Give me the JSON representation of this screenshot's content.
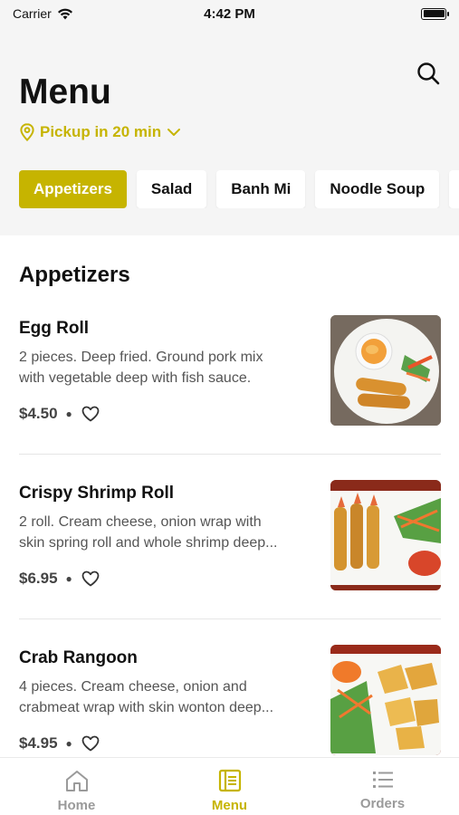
{
  "status_bar": {
    "carrier": "Carrier",
    "time": "4:42 PM"
  },
  "header": {
    "title": "Menu",
    "pickup_label": "Pickup in 20 min"
  },
  "categories": [
    {
      "label": "Appetizers",
      "active": true
    },
    {
      "label": "Salad",
      "active": false
    },
    {
      "label": "Banh Mi",
      "active": false
    },
    {
      "label": "Noodle Soup",
      "active": false
    }
  ],
  "section": {
    "title": "Appetizers"
  },
  "menu_items": [
    {
      "name": "Egg Roll",
      "desc_line1": "2 pieces. Deep fried. Ground pork mix",
      "desc_line2": "with vegetable deep with fish sauce.",
      "price": "$4.50"
    },
    {
      "name": "Crispy Shrimp Roll",
      "desc_line1": "2 roll. Cream cheese, onion wrap with",
      "desc_line2": "skin spring roll and whole shrimp deep...",
      "price": "$6.95"
    },
    {
      "name": "Crab Rangoon",
      "desc_line1": "4 pieces. Cream cheese, onion and",
      "desc_line2": "crabmeat wrap with skin wonton deep...",
      "price": "$4.95"
    }
  ],
  "tab_bar": {
    "home": "Home",
    "menu": "Menu",
    "orders": "Orders"
  },
  "colors": {
    "accent": "#c6b400",
    "header_bg": "#f5f5f5",
    "inactive_tab": "#9a9a9a"
  },
  "icons": {
    "search": "search-icon",
    "pickup": "location-pin-icon",
    "dropdown": "chevron-down-icon",
    "favorite": "heart-icon",
    "home": "home-icon",
    "menu": "menu-book-icon",
    "orders": "list-icon"
  }
}
